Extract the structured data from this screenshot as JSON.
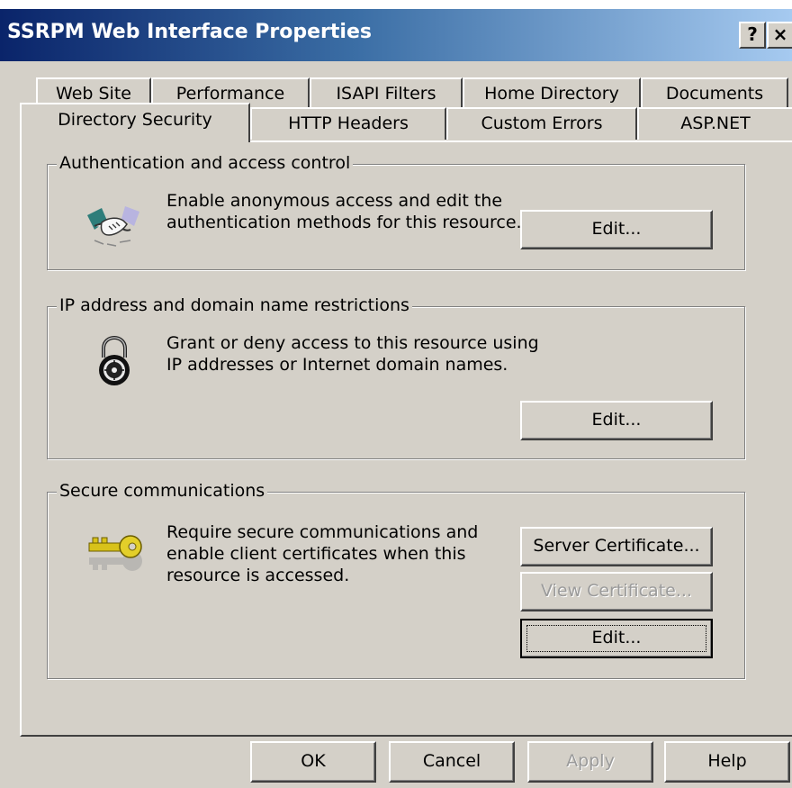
{
  "window": {
    "title": "SSRPM Web Interface Properties",
    "help_label": "?",
    "close_label": "×"
  },
  "tabs": {
    "row1": [
      "Web Site",
      "Performance",
      "ISAPI Filters",
      "Home Directory",
      "Documents"
    ],
    "row2": [
      "Directory Security",
      "HTTP Headers",
      "Custom Errors",
      "ASP.NET"
    ],
    "active": "Directory Security"
  },
  "groups": {
    "auth": {
      "label": "Authentication and access control",
      "description": "Enable anonymous access and edit the\nauthentication methods for this resource.",
      "edit_label": "Edit...",
      "icon": "handshake-icon"
    },
    "ip": {
      "label": "IP address and domain name restrictions",
      "description": "Grant or deny access to this resource using\nIP addresses or Internet domain names.",
      "edit_label": "Edit...",
      "icon": "padlock-icon"
    },
    "secure": {
      "label": "Secure communications",
      "description": "Require secure communications and\nenable client certificates when this\nresource is accessed.",
      "server_cert_label": "Server Certificate...",
      "view_cert_label": "View Certificate...",
      "edit_label": "Edit...",
      "icon": "key-icon"
    }
  },
  "footer": {
    "ok_label": "OK",
    "cancel_label": "Cancel",
    "apply_label": "Apply",
    "help_label": "Help"
  },
  "colors": {
    "face": "#d4d0c8",
    "title_start": "#0a246a",
    "title_end": "#a6caf0",
    "disabled_text": "#9a9a9a"
  }
}
